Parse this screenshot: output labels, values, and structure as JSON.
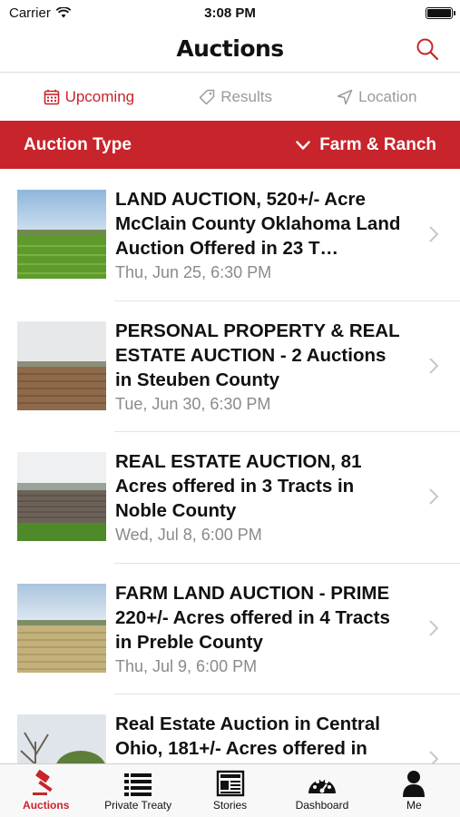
{
  "status_bar": {
    "carrier": "Carrier",
    "time": "3:08 PM",
    "icons": [
      "wifi-icon",
      "battery-icon"
    ]
  },
  "nav": {
    "title": "Auctions",
    "search_icon": "search-icon"
  },
  "tabs": [
    {
      "label": "Upcoming",
      "icon": "calendar-icon",
      "active": true
    },
    {
      "label": "Results",
      "icon": "tag-icon",
      "active": false
    },
    {
      "label": "Location",
      "icon": "location-arrow-icon",
      "active": false
    }
  ],
  "filter": {
    "label": "Auction Type",
    "value": "Farm & Ranch"
  },
  "listings": [
    {
      "title": "LAND AUCTION, 520+/- Acre McClain County Oklahoma Land Auction Offered in 23 T…",
      "date": "Thu, Jun 25,  6:30 PM"
    },
    {
      "title": "PERSONAL PROPERTY & REAL ESTATE AUCTION - 2 Auctions in Steuben County",
      "date": "Tue, Jun 30,  6:30 PM"
    },
    {
      "title": "REAL ESTATE AUCTION, 81 Acres offered in 3 Tracts in Noble County",
      "date": "Wed, Jul  8,  6:00 PM"
    },
    {
      "title": "FARM LAND AUCTION - PRIME 220+/- Acres offered in 4 Tracts in Preble County",
      "date": "Thu, Jul  9,  6:00 PM"
    },
    {
      "title": "Real Estate Auction in Central Ohio, 181+/- Acres offered in",
      "date": ""
    }
  ],
  "tab_bar": [
    {
      "label": "Auctions",
      "icon": "gavel-icon",
      "active": true
    },
    {
      "label": "Private Treaty",
      "icon": "list-icon",
      "active": false
    },
    {
      "label": "Stories",
      "icon": "newspaper-icon",
      "active": false
    },
    {
      "label": "Dashboard",
      "icon": "dashboard-icon",
      "active": false
    },
    {
      "label": "Me",
      "icon": "person-icon",
      "active": false
    }
  ],
  "colors": {
    "accent": "#c8242b",
    "muted_text": "#8a8a8a"
  }
}
